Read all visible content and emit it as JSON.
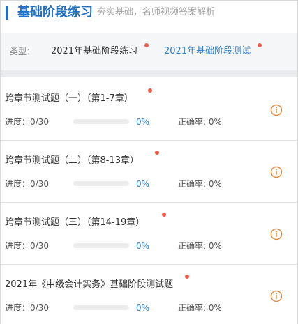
{
  "header": {
    "title": "基础阶段练习",
    "subtitle": "夯实基础，名师视频答案解析"
  },
  "types": {
    "label": "类型：",
    "options": [
      {
        "label": "2021年基础阶段练习",
        "selected": false
      },
      {
        "label": "2021年基础阶段测试",
        "selected": true
      }
    ]
  },
  "colors": {
    "accent": "#1f6fc5",
    "link": "#2f7ec9",
    "badge": "#f25a47",
    "info_icon": "#e8883a"
  },
  "list": {
    "items": [
      {
        "title": "跨章节测试题（一）（第1-7章）",
        "progress_label": "进度：0/30",
        "progress": 0,
        "percent": "0%",
        "accuracy": "正确率: 0%",
        "icon": "info-icon"
      },
      {
        "title": "跨章节测试题（二）（第8-13章）",
        "progress_label": "进度：0/30",
        "progress": 0,
        "percent": "0%",
        "accuracy": "正确率: 0%",
        "icon": "info-icon"
      },
      {
        "title": "跨章节测试题（三）（第14-19章）",
        "progress_label": "进度：0/30",
        "progress": 0,
        "percent": "0%",
        "accuracy": "正确率: 0%",
        "icon": "info-icon"
      },
      {
        "title": "2021年《中级会计实务》基础阶段测试题",
        "progress_label": "进度：0/30",
        "progress": 0,
        "percent": "0%",
        "accuracy": "正确率: 0%",
        "icon": "info-icon"
      }
    ]
  }
}
